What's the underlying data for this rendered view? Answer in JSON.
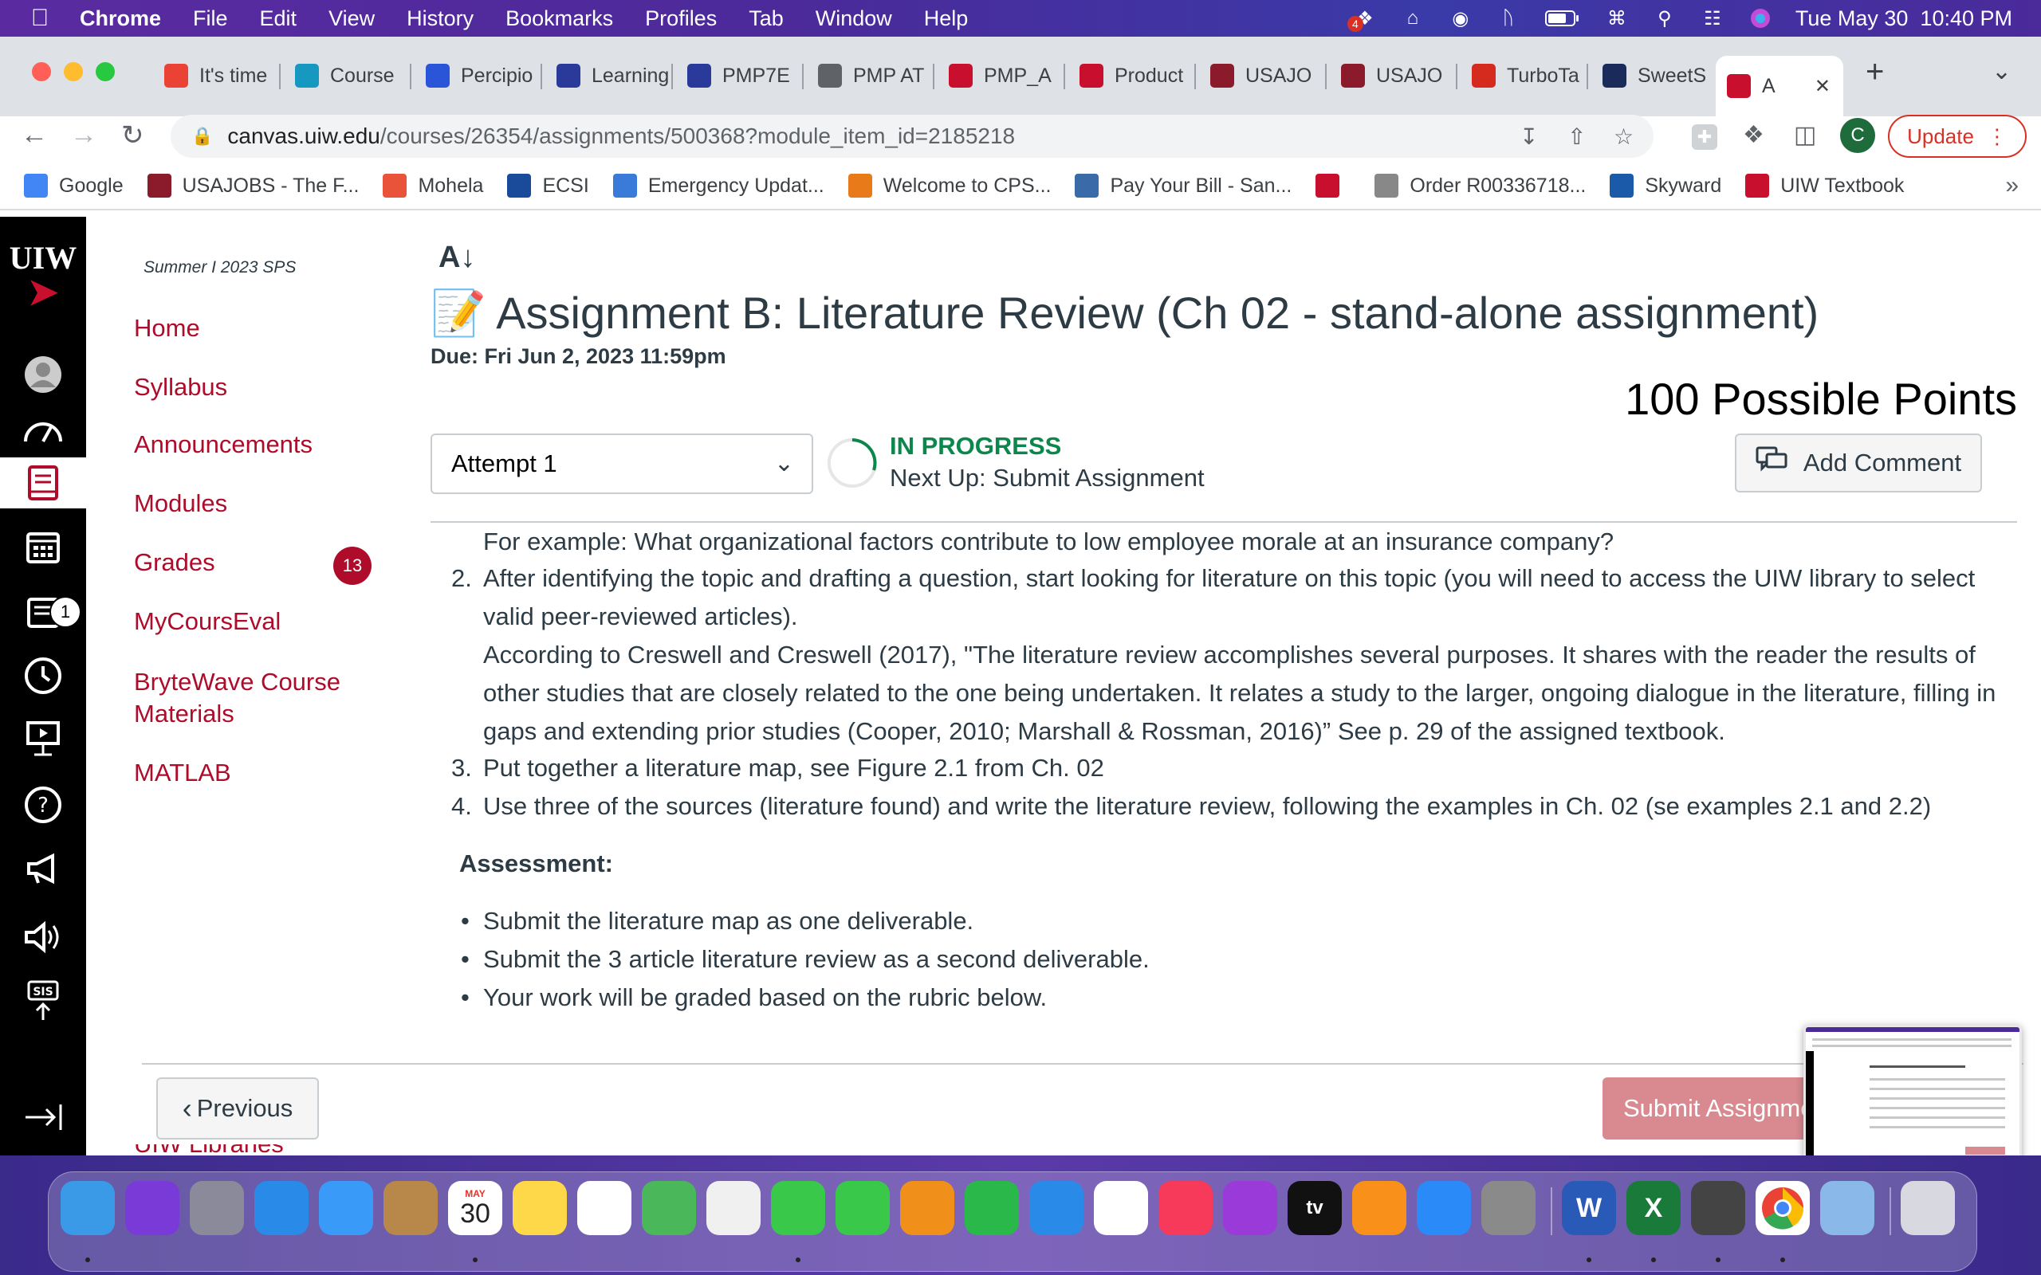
{
  "os_menubar": {
    "app_name": "Chrome",
    "menus": [
      "File",
      "Edit",
      "View",
      "History",
      "Bookmarks",
      "Profiles",
      "Tab",
      "Window",
      "Help"
    ],
    "dropbox_badge": "4",
    "datetime": "Tue May 30  10:40 PM"
  },
  "browser": {
    "tabs": [
      {
        "label": "It's time",
        "icon": "gmail-icon",
        "color": "#ea4335"
      },
      {
        "label": "Course",
        "icon": "salesforce-cloud-icon",
        "color": "#1798c1"
      },
      {
        "label": "Percipio",
        "icon": "percipio-icon",
        "color": "#2a55d8"
      },
      {
        "label": "Learning",
        "icon": "book-icon",
        "color": "#2a3a9a"
      },
      {
        "label": "PMP7E",
        "icon": "book-icon",
        "color": "#2a3a9a"
      },
      {
        "label": "PMP AT",
        "icon": "globe-icon",
        "color": "#5f6368"
      },
      {
        "label": "PMP_A",
        "icon": "pm-icon",
        "color": "#c8102e"
      },
      {
        "label": "Product",
        "icon": "pm-icon",
        "color": "#c8102e"
      },
      {
        "label": "USAJO",
        "icon": "usajobs-eagle-icon",
        "color": "#8b1a2a"
      },
      {
        "label": "USAJO",
        "icon": "usajobs-eagle-icon",
        "color": "#8b1a2a"
      },
      {
        "label": "TurboTa",
        "icon": "turbotax-check-icon",
        "color": "#d52b1e"
      },
      {
        "label": "SweetS",
        "icon": "sweetshop-icon",
        "color": "#1a2a5a"
      },
      {
        "label": "A",
        "icon": "uiw-cardinal-icon",
        "color": "#c8102e"
      }
    ],
    "new_tab": "+",
    "url_host": "canvas.uiw.edu",
    "url_path": "/courses/26354/assignments/500368?module_item_id=2185218",
    "profile_initial": "C",
    "update_label": "Update",
    "bookmarks": [
      {
        "label": "Google",
        "icon": "google-g-icon",
        "color": "#4285f4"
      },
      {
        "label": "USAJOBS - The F...",
        "icon": "usajobs-eagle-icon",
        "color": "#8b1a2a"
      },
      {
        "label": "Mohela",
        "icon": "mohela-icon",
        "color": "#e8533a"
      },
      {
        "label": "ECSI",
        "icon": "ecsi-icon",
        "color": "#1a4a9a"
      },
      {
        "label": "Emergency Updat...",
        "icon": "snowflake-icon",
        "color": "#3a7ad8"
      },
      {
        "label": "Welcome to CPS...",
        "icon": "cps-icon",
        "color": "#e87a1a"
      },
      {
        "label": "Pay Your Bill - San...",
        "icon": "building-icon",
        "color": "#3a6aa8"
      },
      {
        "label": "",
        "icon": "cisco-icon",
        "color": "#c8102e"
      },
      {
        "label": "Order R00336718...",
        "icon": "order-icon",
        "color": "#888888"
      },
      {
        "label": "Skyward",
        "icon": "skyward-icon",
        "color": "#1a5aa8"
      },
      {
        "label": "UIW Textbook",
        "icon": "uiw-cardinal-icon",
        "color": "#c8102e"
      }
    ],
    "more_bookmarks": "»"
  },
  "canvas": {
    "logo_text": "UIW",
    "inbox_badge": "1",
    "course_nav": {
      "term": "Summer I 2023 SPS",
      "items": [
        "Home",
        "Syllabus",
        "Announcements",
        "Modules",
        "Grades",
        "MyCoursEval",
        "BryteWave Course Materials",
        "MATLAB"
      ],
      "grades_badge": "13",
      "partial_item": "UIW Libraries"
    },
    "assignment": {
      "title": "📝 Assignment B: Literature Review (Ch 02 - stand-alone assignment)",
      "due": "Due: Fri Jun 2, 2023 11:59pm",
      "points": "100 Possible Points",
      "attempt_label": "Attempt 1",
      "status": "IN PROGRESS",
      "next_up": "Next Up: Submit Assignment",
      "add_comment": "Add Comment"
    },
    "content": {
      "example_line": "For example: What organizational factors contribute to low employee morale at an insurance company?",
      "list_items": [
        {
          "num": "2.",
          "text": "After identifying the topic and drafting a question, start looking for literature on this topic (you will need to access the UIW library to select valid peer-reviewed articles)."
        },
        {
          "num": "3.",
          "text": "Put together a literature map, see Figure 2.1 from Ch. 02"
        },
        {
          "num": "4.",
          "text": "Use three of the sources (literature found) and write the literature review, following the examples in Ch. 02 (se examples 2.1 and 2.2)"
        }
      ],
      "quote": "According to Creswell and Creswell (2017), \"The literature review accomplishes several purposes. It shares with the reader the results of other studies that are closely related to the one being undertaken. It relates a study to the larger, ongoing dialogue in the literature, filling in gaps and extending prior studies (Cooper, 2010; Marshall & Rossman, 2016)” See p. 29 of the assigned textbook.",
      "assessment_heading": "Assessment:",
      "bullets": [
        "Submit the literature map as one deliverable.",
        "Submit the 3 article literature review as a second deliverable.",
        "Your work will be graded based on the rubric below."
      ]
    },
    "footer": {
      "previous": "Previous",
      "submit": "Submit Assignment"
    }
  },
  "dock": {
    "calendar_month": "MAY",
    "calendar_day": "30",
    "apps": [
      "finder-icon",
      "siri-icon",
      "launchpad-icon",
      "safari-icon",
      "mail-icon",
      "contacts-icon",
      "calendar-icon",
      "notes-icon",
      "reminders-icon",
      "maps-icon",
      "photos-icon",
      "messages-icon",
      "facetime-icon",
      "pages-icon",
      "numbers-icon",
      "keynote-icon",
      "news-icon",
      "music-icon",
      "podcasts-icon",
      "tv-icon",
      "books-icon",
      "appstore-icon",
      "system-settings-icon",
      "word-icon",
      "excel-icon",
      "alfred-icon",
      "chrome-icon",
      "preview-icon",
      "trash-icon"
    ],
    "tv_label": "tv"
  }
}
